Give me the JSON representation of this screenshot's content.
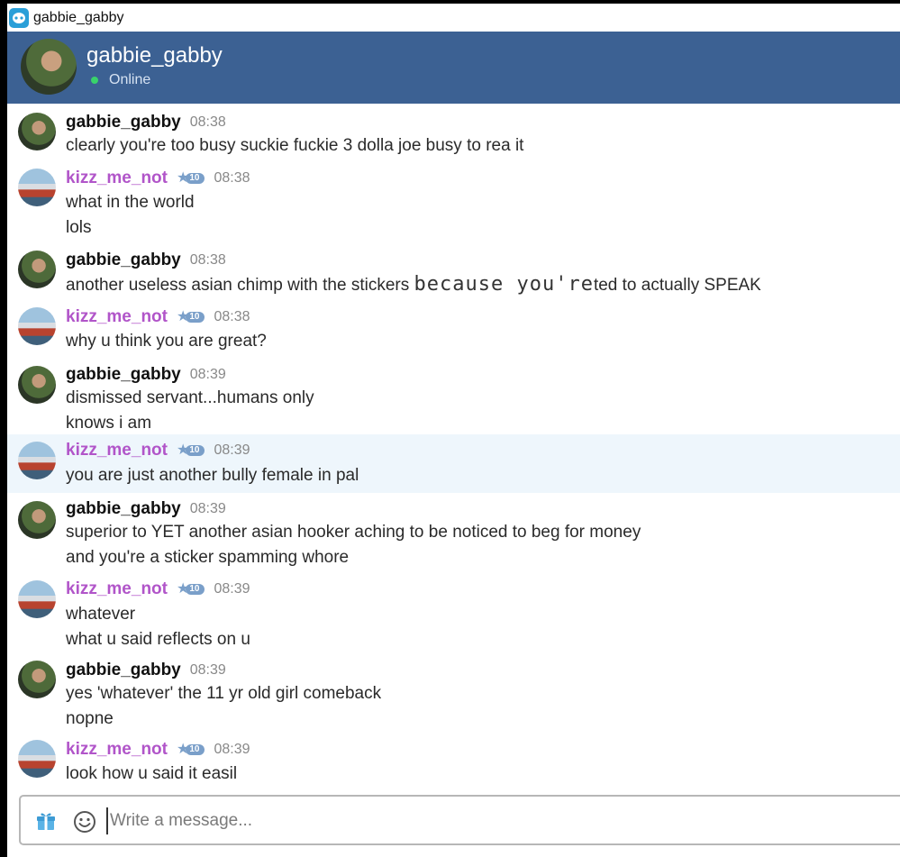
{
  "window": {
    "title": "gabbie_gabby",
    "icon": "chat-app-icon"
  },
  "header": {
    "name": "gabbie_gabby",
    "status": "Online",
    "status_color": "#39d36b",
    "background": "#3c6193"
  },
  "colors": {
    "gabbie_name": "#111111",
    "kizz_name": "#b155c9",
    "badge": "#7a9fc9",
    "highlight": "#eef6fc"
  },
  "messages": [
    {
      "user": "gabbie_gabby",
      "time": "08:38",
      "lines": [
        "clearly you're too busy suckie fuckie 3 dolla joe busy to rea it"
      ]
    },
    {
      "user": "kizz_me_not",
      "badge": "10",
      "time": "08:38",
      "lines": [
        "what in the world",
        "lols"
      ]
    },
    {
      "user": "gabbie_gabby",
      "time": "08:38",
      "lines": [
        "another useless asian chimp with the stickers",
        "because you're",
        "ted to actually SPEAK"
      ]
    },
    {
      "user": "kizz_me_not",
      "badge": "10",
      "time": "08:38",
      "lines": [
        "why u think you are great?"
      ]
    },
    {
      "user": "gabbie_gabby",
      "time": "08:39",
      "lines": [
        "dismissed servant...humans only",
        "knows i am"
      ]
    },
    {
      "user": "kizz_me_not",
      "badge": "10",
      "time": "08:39",
      "lines": [
        "you are just another bully female in pal"
      ]
    },
    {
      "user": "gabbie_gabby",
      "time": "08:39",
      "lines": [
        "superior to YET another asian hooker aching to be noticed to beg for money",
        "and you're a sticker spamming whore"
      ]
    },
    {
      "user": "kizz_me_not",
      "badge": "10",
      "time": "08:39",
      "lines": [
        "whatever",
        "what u said reflects on u"
      ]
    },
    {
      "user": "gabbie_gabby",
      "time": "08:39",
      "lines": [
        "yes 'whatever' the 11 yr old girl comeback",
        "nopne"
      ]
    },
    {
      "user": "kizz_me_not",
      "badge": "10",
      "time": "08:39",
      "lines": [
        "look how u said it easil"
      ]
    }
  ],
  "composer": {
    "placeholder": "Write a message...",
    "value": ""
  }
}
